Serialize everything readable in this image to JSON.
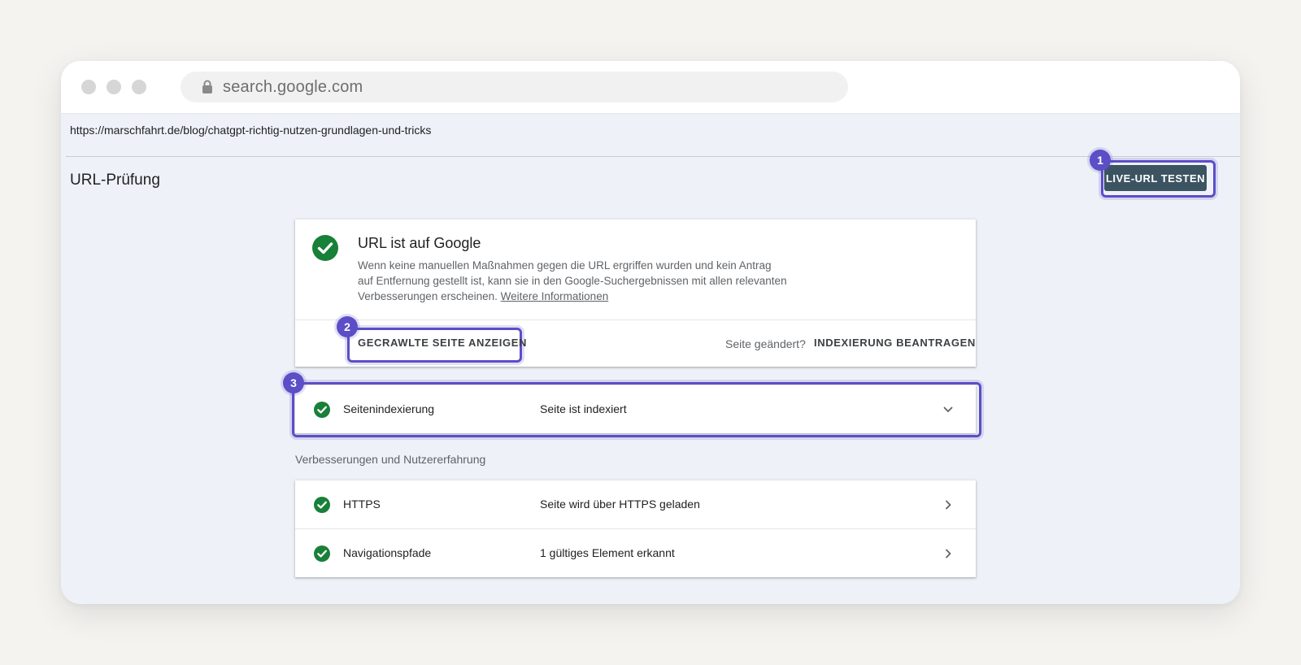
{
  "browser": {
    "address": "search.google.com",
    "url": "https://marschfahrt.de/blog/chatgpt-richtig-nutzen-grundlagen-und-tricks"
  },
  "page": {
    "title": "URL-Prüfung",
    "live_button": "LIVE-URL TESTEN"
  },
  "status_card": {
    "title": "URL ist auf Google",
    "description": "Wenn keine manuellen Maßnahmen gegen die URL ergriffen wurden und kein Antrag auf Entfernung gestellt ist, kann sie in den Google-Suchergebnissen mit allen relevanten Verbesserungen erscheinen.",
    "more_link": "Weitere Informationen",
    "crawl_button": "GECRAWLTE SEITE ANZEIGEN",
    "changed_prompt": "Seite geändert?",
    "request_button": "INDEXIERUNG BEANTRAGEN"
  },
  "indexing": {
    "label": "Seitenindexierung",
    "value": "Seite ist indexiert"
  },
  "enhancements": {
    "section_title": "Verbesserungen und Nutzererfahrung",
    "rows": [
      {
        "label": "HTTPS",
        "value": "Seite wird über HTTPS geladen"
      },
      {
        "label": "Navigationspfade",
        "value": "1 gültiges Element erkannt"
      }
    ]
  },
  "callouts": [
    "1",
    "2",
    "3"
  ],
  "colors": {
    "accent": "#5b4ec7",
    "success": "#188038",
    "button_dark": "#3c5461"
  }
}
